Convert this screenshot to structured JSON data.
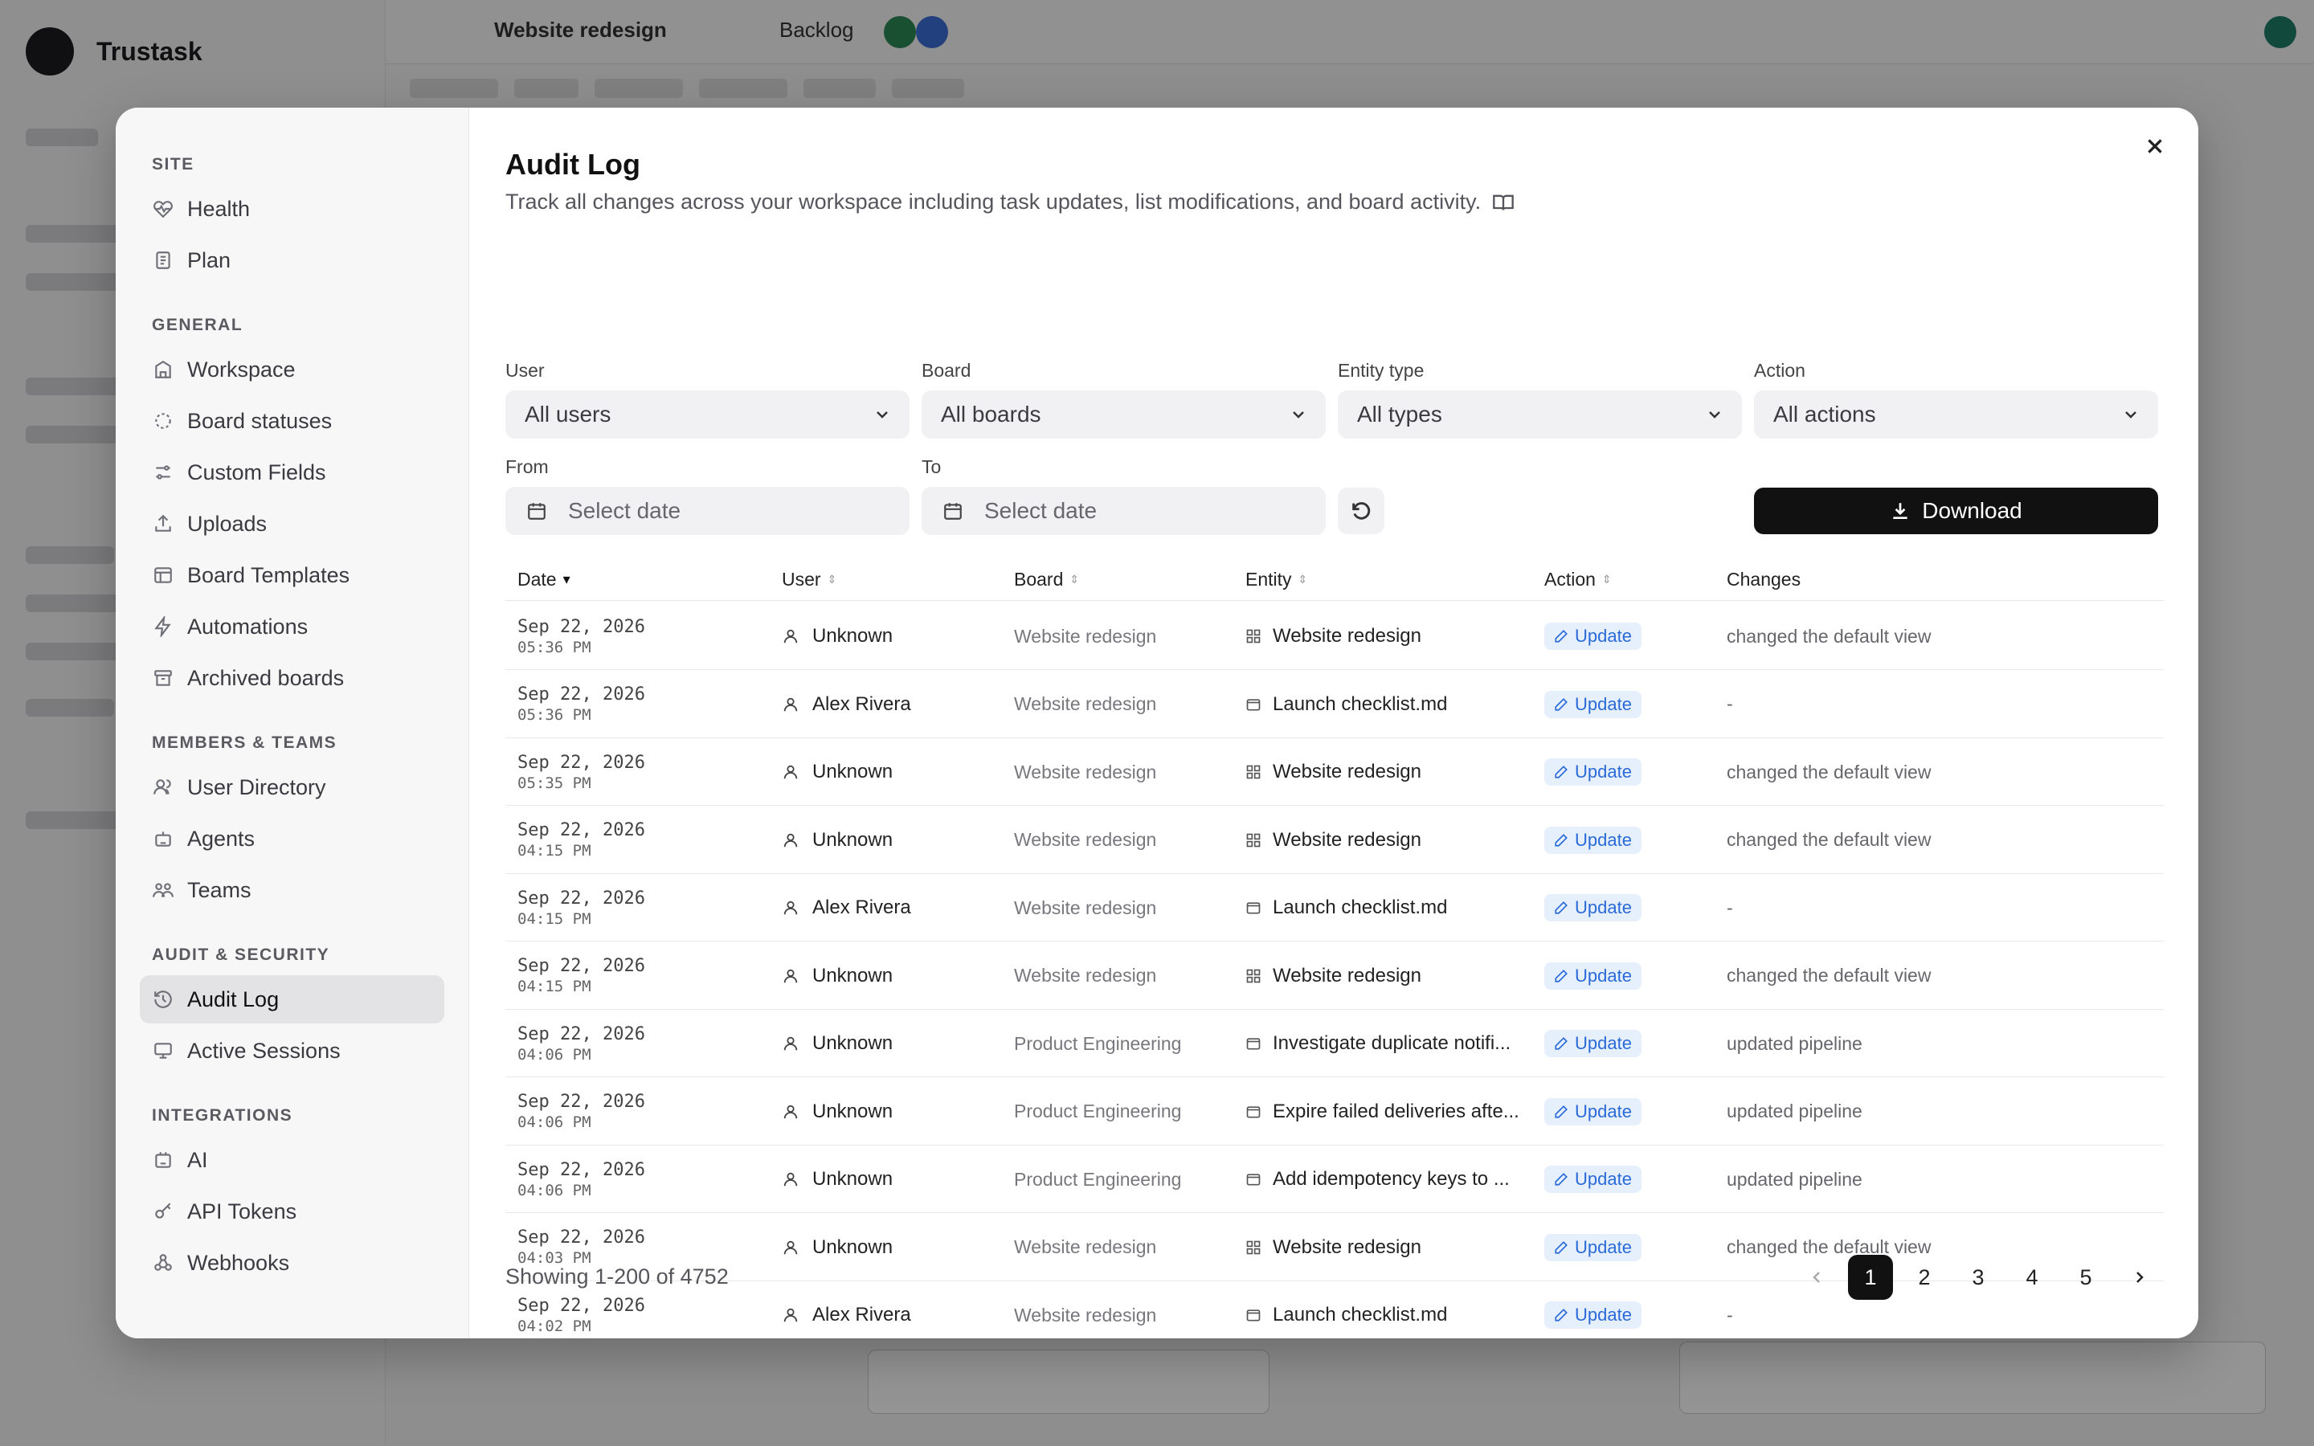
{
  "background": {
    "brand": "Trustask",
    "crumb_board": "Website redesign",
    "crumb_status": "Backlog"
  },
  "sidebar": {
    "sections": [
      {
        "title": "SITE",
        "items": [
          {
            "label": "Health",
            "icon": "heart-pulse-icon"
          },
          {
            "label": "Plan",
            "icon": "receipt-icon"
          }
        ]
      },
      {
        "title": "GENERAL",
        "items": [
          {
            "label": "Workspace",
            "icon": "building-icon"
          },
          {
            "label": "Board statuses",
            "icon": "dashed-circle-icon"
          },
          {
            "label": "Custom Fields",
            "icon": "sliders-icon"
          },
          {
            "label": "Uploads",
            "icon": "upload-icon"
          },
          {
            "label": "Board Templates",
            "icon": "template-icon"
          },
          {
            "label": "Automations",
            "icon": "bolt-icon"
          },
          {
            "label": "Archived boards",
            "icon": "archive-icon"
          }
        ]
      },
      {
        "title": "MEMBERS & TEAMS",
        "items": [
          {
            "label": "User Directory",
            "icon": "users-icon"
          },
          {
            "label": "Agents",
            "icon": "robot-icon"
          },
          {
            "label": "Teams",
            "icon": "team-icon"
          }
        ]
      },
      {
        "title": "AUDIT & SECURITY",
        "items": [
          {
            "label": "Audit Log",
            "icon": "history-icon",
            "active": true
          },
          {
            "label": "Active Sessions",
            "icon": "monitor-icon"
          }
        ]
      },
      {
        "title": "INTEGRATIONS",
        "items": [
          {
            "label": "AI",
            "icon": "ai-icon"
          },
          {
            "label": "API Tokens",
            "icon": "key-icon"
          },
          {
            "label": "Webhooks",
            "icon": "webhook-icon"
          }
        ]
      }
    ]
  },
  "main": {
    "title": "Audit Log",
    "subtitle": "Track all changes across your workspace including task updates, list modifications, and board activity.",
    "filters": {
      "user": {
        "label": "User",
        "value": "All users"
      },
      "board": {
        "label": "Board",
        "value": "All boards"
      },
      "entity_type": {
        "label": "Entity type",
        "value": "All types"
      },
      "action": {
        "label": "Action",
        "value": "All actions"
      },
      "from": {
        "label": "From",
        "placeholder": "Select date"
      },
      "to": {
        "label": "To",
        "placeholder": "Select date"
      }
    },
    "download_label": "Download",
    "columns": [
      "Date",
      "User",
      "Board",
      "Entity",
      "Action",
      "Changes"
    ],
    "rows": [
      {
        "date": "Sep 22, 2026",
        "time": "05:36 PM",
        "user": "Unknown",
        "board": "Website redesign",
        "entity": "Website redesign",
        "entity_icon": "board-icon",
        "action": "Update",
        "changes": "changed the default view"
      },
      {
        "date": "Sep 22, 2026",
        "time": "05:36 PM",
        "user": "Alex Rivera",
        "board": "Website redesign",
        "entity": "Launch checklist.md",
        "entity_icon": "file-icon",
        "action": "Update",
        "changes": "-"
      },
      {
        "date": "Sep 22, 2026",
        "time": "05:35 PM",
        "user": "Unknown",
        "board": "Website redesign",
        "entity": "Website redesign",
        "entity_icon": "board-icon",
        "action": "Update",
        "changes": "changed the default view"
      },
      {
        "date": "Sep 22, 2026",
        "time": "04:15 PM",
        "user": "Unknown",
        "board": "Website redesign",
        "entity": "Website redesign",
        "entity_icon": "board-icon",
        "action": "Update",
        "changes": "changed the default view"
      },
      {
        "date": "Sep 22, 2026",
        "time": "04:15 PM",
        "user": "Alex Rivera",
        "board": "Website redesign",
        "entity": "Launch checklist.md",
        "entity_icon": "file-icon",
        "action": "Update",
        "changes": "-"
      },
      {
        "date": "Sep 22, 2026",
        "time": "04:15 PM",
        "user": "Unknown",
        "board": "Website redesign",
        "entity": "Website redesign",
        "entity_icon": "board-icon",
        "action": "Update",
        "changes": "changed the default view"
      },
      {
        "date": "Sep 22, 2026",
        "time": "04:06 PM",
        "user": "Unknown",
        "board": "Product Engineering",
        "entity": "Investigate duplicate notifi...",
        "entity_icon": "file-icon",
        "action": "Update",
        "changes": "updated pipeline"
      },
      {
        "date": "Sep 22, 2026",
        "time": "04:06 PM",
        "user": "Unknown",
        "board": "Product Engineering",
        "entity": "Expire failed deliveries afte...",
        "entity_icon": "file-icon",
        "action": "Update",
        "changes": "updated pipeline"
      },
      {
        "date": "Sep 22, 2026",
        "time": "04:06 PM",
        "user": "Unknown",
        "board": "Product Engineering",
        "entity": "Add idempotency keys to ...",
        "entity_icon": "file-icon",
        "action": "Update",
        "changes": "updated pipeline"
      },
      {
        "date": "Sep 22, 2026",
        "time": "04:03 PM",
        "user": "Unknown",
        "board": "Website redesign",
        "entity": "Website redesign",
        "entity_icon": "board-icon",
        "action": "Update",
        "changes": "changed the default view"
      },
      {
        "date": "Sep 22, 2026",
        "time": "04:02 PM",
        "user": "Alex Rivera",
        "board": "Website redesign",
        "entity": "Launch checklist.md",
        "entity_icon": "file-icon",
        "action": "Update",
        "changes": "-"
      }
    ],
    "footer": "Showing 1-200 of 4752",
    "pages": [
      "1",
      "2",
      "3",
      "4",
      "5"
    ],
    "current_page": "1",
    "colors": {
      "badge_bg": "#e6f0fd",
      "badge_text": "#2a6ad8",
      "primary": "#111111"
    }
  }
}
